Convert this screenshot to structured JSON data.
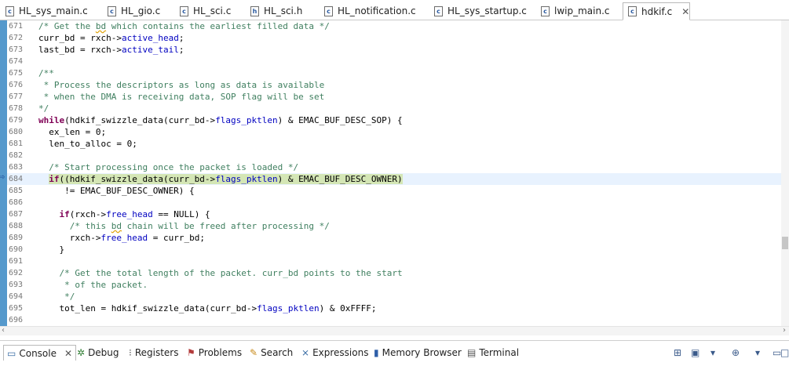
{
  "editor_tabs": [
    {
      "label": "HL_sys_main.c",
      "icon": "c-file-icon",
      "glyph": "c"
    },
    {
      "label": "HL_gio.c",
      "icon": "c-file-icon",
      "glyph": "c"
    },
    {
      "label": "HL_sci.c",
      "icon": "c-file-icon",
      "glyph": "c"
    },
    {
      "label": "HL_sci.h",
      "icon": "h-file-icon",
      "glyph": "h"
    },
    {
      "label": "HL_notification.c",
      "icon": "c-file-icon",
      "glyph": "c"
    },
    {
      "label": "HL_sys_startup.c",
      "icon": "c-file-icon",
      "glyph": "c"
    },
    {
      "label": "lwip_main.c",
      "icon": "c-file-icon",
      "glyph": "c"
    },
    {
      "label": "hdkif.c",
      "icon": "c-file-icon",
      "glyph": "c",
      "active": true
    }
  ],
  "tab_close_glyph": "✕",
  "current_line_marker": "⇨",
  "code_lines": [
    {
      "n": "671",
      "segs": [
        [
          "cm",
          "/* Get the "
        ],
        [
          "cm sq",
          "bd"
        ],
        [
          "cm",
          " which contains the earliest filled data */"
        ]
      ]
    },
    {
      "n": "672",
      "segs": [
        [
          "",
          "curr_bd = rxch->"
        ],
        [
          "fld",
          "active_head"
        ],
        [
          "",
          ";"
        ]
      ]
    },
    {
      "n": "673",
      "segs": [
        [
          "",
          "last_bd = rxch->"
        ],
        [
          "fld",
          "active_tail"
        ],
        [
          "",
          ";"
        ]
      ]
    },
    {
      "n": "674",
      "segs": []
    },
    {
      "n": "675",
      "segs": [
        [
          "cm",
          "/**"
        ]
      ]
    },
    {
      "n": "676",
      "segs": [
        [
          "cm",
          " * Process the descriptors as long as data is available"
        ]
      ]
    },
    {
      "n": "677",
      "segs": [
        [
          "cm",
          " * when the DMA is receiving data, SOP flag will be set"
        ]
      ]
    },
    {
      "n": "678",
      "segs": [
        [
          "cm",
          "*/"
        ]
      ]
    },
    {
      "n": "679",
      "segs": [
        [
          "kw",
          "while"
        ],
        [
          "",
          "(hdkif_swizzle_data(curr_bd->"
        ],
        [
          "fld",
          "flags_pktlen"
        ],
        [
          "",
          ") & EMAC_BUF_DESC_SOP) {"
        ]
      ]
    },
    {
      "n": "680",
      "segs": [
        [
          "",
          "  ex_len = 0;"
        ]
      ]
    },
    {
      "n": "681",
      "segs": [
        [
          "",
          "  len_to_alloc = 0;"
        ]
      ]
    },
    {
      "n": "682",
      "segs": []
    },
    {
      "n": "683",
      "segs": [
        [
          "cm",
          "  /* Start processing once the packet is loaded */"
        ]
      ]
    },
    {
      "n": "684",
      "current": true,
      "segs": [
        [
          "",
          "  "
        ],
        [
          "hl kw",
          "if"
        ],
        [
          "hl",
          "((hdkif_swizzle_data(curr_bd->"
        ],
        [
          "hl fld",
          "flags_pktlen"
        ],
        [
          "hl",
          ") & EMAC_BUF_DESC_OWNER)"
        ]
      ]
    },
    {
      "n": "685",
      "segs": [
        [
          "",
          "     != EMAC_BUF_DESC_OWNER) {"
        ]
      ]
    },
    {
      "n": "686",
      "segs": []
    },
    {
      "n": "687",
      "segs": [
        [
          "",
          "    "
        ],
        [
          "kw",
          "if"
        ],
        [
          "",
          "(rxch->"
        ],
        [
          "fld",
          "free_head"
        ],
        [
          "",
          " == NULL) {"
        ]
      ]
    },
    {
      "n": "688",
      "segs": [
        [
          "cm",
          "      /* this "
        ],
        [
          "cm sq",
          "bd"
        ],
        [
          "cm",
          " chain will be freed after processing */"
        ]
      ]
    },
    {
      "n": "689",
      "segs": [
        [
          "",
          "      rxch->"
        ],
        [
          "fld",
          "free_head"
        ],
        [
          "",
          " = curr_bd;"
        ]
      ]
    },
    {
      "n": "690",
      "segs": [
        [
          "",
          "    }"
        ]
      ]
    },
    {
      "n": "691",
      "segs": []
    },
    {
      "n": "692",
      "segs": [
        [
          "cm",
          "    /* Get the total length of the packet. curr_bd points to the start"
        ]
      ]
    },
    {
      "n": "693",
      "segs": [
        [
          "cm",
          "     * of the packet."
        ]
      ]
    },
    {
      "n": "694",
      "segs": [
        [
          "cm",
          "     */"
        ]
      ]
    },
    {
      "n": "695",
      "segs": [
        [
          "",
          "    tot_len = hdkif_swizzle_data(curr_bd->"
        ],
        [
          "fld",
          "flags_pktlen"
        ],
        [
          "",
          ") & 0xFFFF;"
        ]
      ]
    },
    {
      "n": "696",
      "segs": []
    }
  ],
  "scroll_arrows": {
    "left": "‹",
    "right": "›"
  },
  "panel_tabs": [
    {
      "label": "Console",
      "icon": "console-icon",
      "glyph": "▭",
      "color": "#3b6ea5",
      "active": true
    },
    {
      "label": "Debug",
      "icon": "debug-icon",
      "glyph": "✲",
      "color": "#2f7d32"
    },
    {
      "label": "Registers",
      "icon": "registers-icon",
      "glyph": "⁝",
      "color": "#555555"
    },
    {
      "label": "Problems",
      "icon": "problems-icon",
      "glyph": "⚑",
      "color": "#b23b3b"
    },
    {
      "label": "Search",
      "icon": "search-icon",
      "glyph": "✎",
      "color": "#c88a1a"
    },
    {
      "label": "Expressions",
      "icon": "expressions-icon",
      "glyph": "⨯",
      "color": "#3b6ea5"
    },
    {
      "label": "Memory Browser",
      "icon": "memory-browser-icon",
      "glyph": "▮",
      "color": "#2f5fa8"
    },
    {
      "label": "Terminal",
      "icon": "terminal-icon",
      "glyph": "▤",
      "color": "#555555"
    }
  ],
  "panel_close_glyph": "✕",
  "panel_tools": [
    {
      "icon": "new-console-icon",
      "glyph": "⊞"
    },
    {
      "icon": "display-console-icon",
      "glyph": "▣"
    },
    {
      "icon": "display-dropdown-icon",
      "glyph": "▾"
    },
    {
      "icon": "open-console-icon",
      "glyph": "⊕"
    },
    {
      "icon": "open-dropdown-icon",
      "glyph": "▾"
    },
    {
      "icon": "minimize-icon",
      "glyph": "▭"
    },
    {
      "icon": "maximize-icon",
      "glyph": "□"
    }
  ]
}
